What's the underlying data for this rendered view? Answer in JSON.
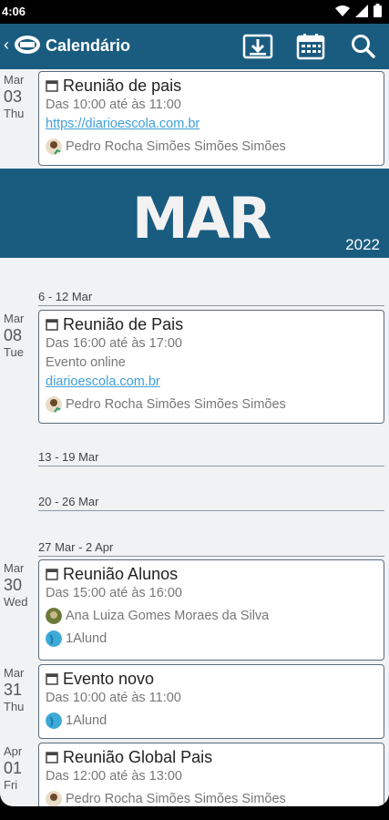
{
  "status": {
    "time": "4:06"
  },
  "appbar": {
    "title": "Calendário"
  },
  "banner": {
    "month": "MAR",
    "year": "2022"
  },
  "weeks": [
    "6 - 12 Mar",
    "13 - 19 Mar",
    "20 - 26 Mar",
    "27 Mar - 2 Apr"
  ],
  "events": [
    {
      "month": "Mar",
      "day": "03",
      "weekday": "Thu",
      "title": "Reunião de pais",
      "time": "Das 10:00 até às 11:00",
      "link": "https://diarioescola.com.br",
      "person": "Pedro Rocha Simões Simões Simões"
    },
    {
      "month": "Mar",
      "day": "08",
      "weekday": "Tue",
      "title": "Reunião de Pais",
      "time": "Das 16:00 até às 17:00",
      "note": "Evento online",
      "link": "diarioescola.com.br",
      "person": "Pedro Rocha Simões Simões Simões"
    },
    {
      "month": "Mar",
      "day": "30",
      "weekday": "Wed",
      "title": "Reunião Alunos",
      "time": "Das 15:00 até às 16:00",
      "person": "Ana Luiza Gomes Moraes da Silva",
      "group": "1Alund"
    },
    {
      "month": "Mar",
      "day": "31",
      "weekday": "Thu",
      "title": "Evento novo",
      "time": "Das 10:00 até às 11:00",
      "group": "1Alund"
    },
    {
      "month": "Apr",
      "day": "01",
      "weekday": "Fri",
      "title": "Reunião Global Pais",
      "time": "Das 12:00 até às 13:00",
      "person": "Pedro Rocha Simões Simões Simões"
    }
  ]
}
